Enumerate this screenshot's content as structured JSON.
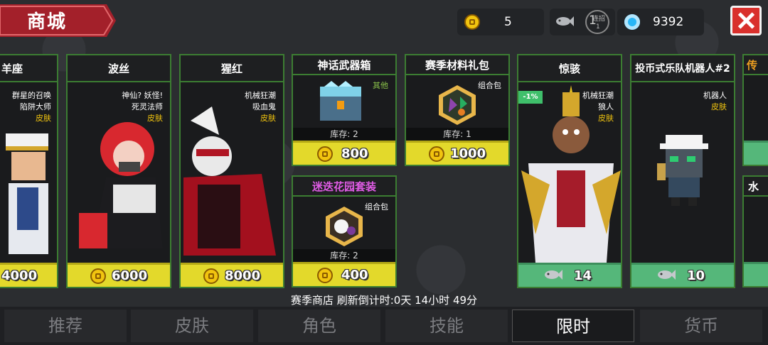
{
  "header": {
    "title": "商城",
    "gold": "5",
    "sep_label": "连招",
    "sep_count": "1",
    "sep_big": "1",
    "gems": "9392"
  },
  "cards": [
    {
      "name": "羊座",
      "tags": [
        "群星的召唤",
        "陷阱大师",
        "皮肤"
      ],
      "price": "4000"
    },
    {
      "name": "波丝",
      "tags": [
        "神仙? 妖怪!",
        "死灵法师",
        "皮肤"
      ],
      "price": "6000"
    },
    {
      "name": "猩红",
      "tags": [
        "机械狂潮",
        "吸血鬼",
        "皮肤"
      ],
      "price": "8000"
    },
    {
      "name": "神话武器箱",
      "tags": [
        "其他"
      ],
      "stock": "库存: 2",
      "price": "800"
    },
    {
      "name": "迷迭花园套装",
      "tags": [
        "组合包"
      ],
      "stock": "库存: 2",
      "price": "400"
    },
    {
      "name": "赛季材料礼包",
      "tags": [
        "组合包"
      ],
      "stock": "库存: 1",
      "price": "1000"
    },
    {
      "name": "惊骇",
      "tags": [
        "机械狂潮",
        "狼人",
        "皮肤"
      ],
      "discount": "-1%",
      "price": "14"
    },
    {
      "name": "投币式乐队机器人#2",
      "tags": [
        "机器人",
        "皮肤"
      ],
      "price": "10"
    },
    {
      "name": "传",
      "tags": [],
      "price": ""
    },
    {
      "name": "水",
      "tags": [],
      "price": ""
    }
  ],
  "refresh_text": "赛季商店 刷新倒计时:0天 14小时 49分",
  "tabs": [
    "推荐",
    "皮肤",
    "角色",
    "技能",
    "限时",
    "货币"
  ],
  "colors": {
    "accent_green": "#3c7d32",
    "price_yellow": "#e3d92b",
    "price_green": "#55b77a",
    "tag_yellow": "#f1c40f",
    "close_red": "#d9302c"
  },
  "icons": [
    "gold-coin-icon",
    "fish-icon",
    "gem-icon",
    "close-icon"
  ]
}
